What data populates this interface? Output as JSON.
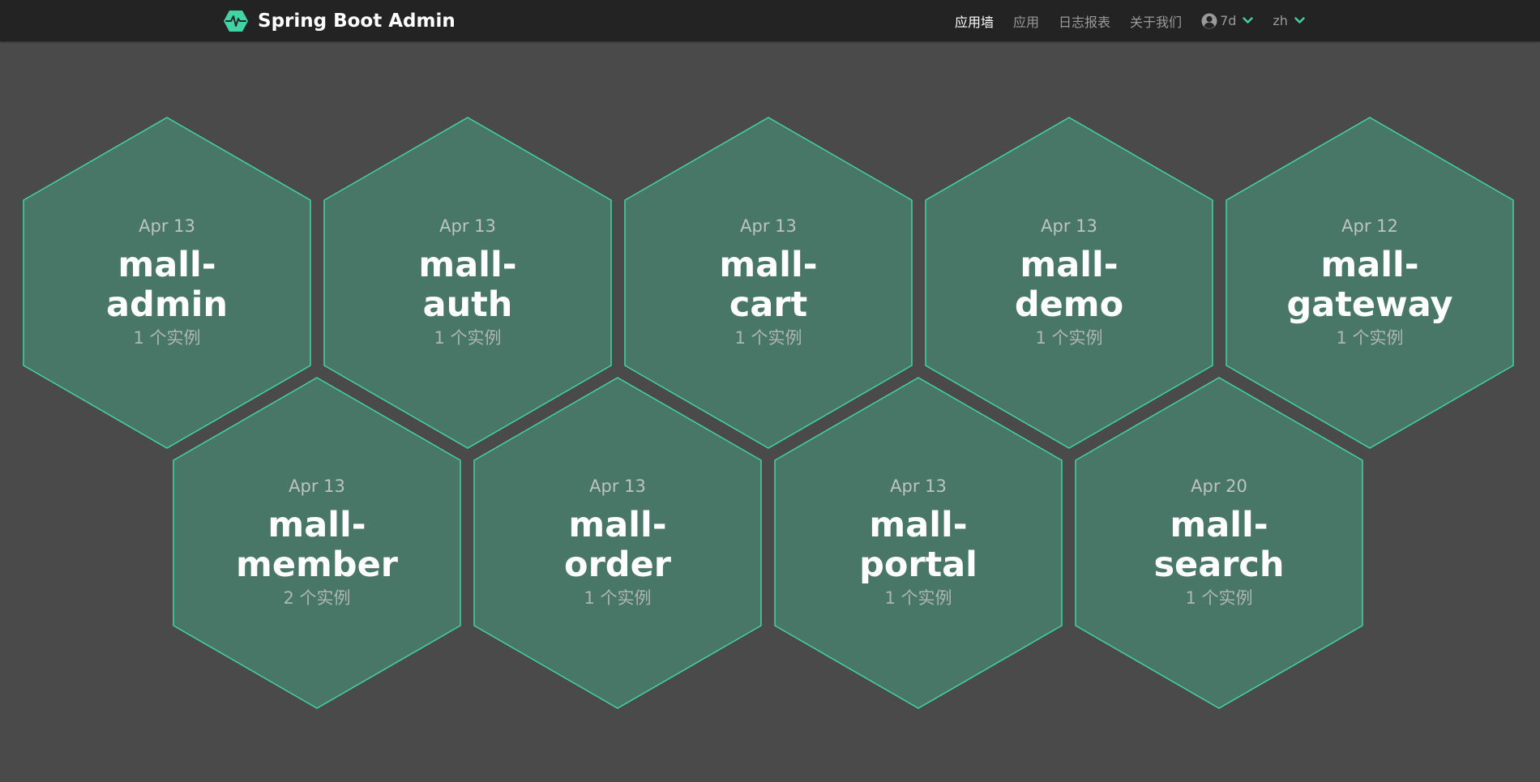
{
  "app": {
    "title": "Spring Boot Admin",
    "accent_color": "#42d3a5",
    "logo_icon": "heartbeat-hexagon-icon"
  },
  "nav": {
    "items": [
      {
        "label": "应用墙",
        "active": true
      },
      {
        "label": "应用",
        "active": false
      },
      {
        "label": "日志报表",
        "active": false
      },
      {
        "label": "关于我们",
        "active": false
      }
    ],
    "user": {
      "label": "7d",
      "icon": "user-circle-icon"
    },
    "language": {
      "label": "zh"
    }
  },
  "applications": [
    {
      "date": "Apr 13",
      "name_line1": "mall-",
      "name_line2": "admin",
      "instances": "1 个实例"
    },
    {
      "date": "Apr 13",
      "name_line1": "mall-",
      "name_line2": "auth",
      "instances": "1 个实例"
    },
    {
      "date": "Apr 13",
      "name_line1": "mall-",
      "name_line2": "cart",
      "instances": "1 个实例"
    },
    {
      "date": "Apr 13",
      "name_line1": "mall-",
      "name_line2": "demo",
      "instances": "1 个实例"
    },
    {
      "date": "Apr 12",
      "name_line1": "mall-",
      "name_line2": "gateway",
      "instances": "1 个实例"
    },
    {
      "date": "Apr 13",
      "name_line1": "mall-",
      "name_line2": "member",
      "instances": "2 个实例"
    },
    {
      "date": "Apr 13",
      "name_line1": "mall-",
      "name_line2": "order",
      "instances": "1 个实例"
    },
    {
      "date": "Apr 13",
      "name_line1": "mall-",
      "name_line2": "portal",
      "instances": "1 个实例"
    },
    {
      "date": "Apr 20",
      "name_line1": "mall-",
      "name_line2": "search",
      "instances": "1 个实例"
    }
  ],
  "colors": {
    "background": "#4a4a4a",
    "navbar": "#232323",
    "hex_fill": "#497767",
    "hex_stroke": "#42d3a5"
  }
}
